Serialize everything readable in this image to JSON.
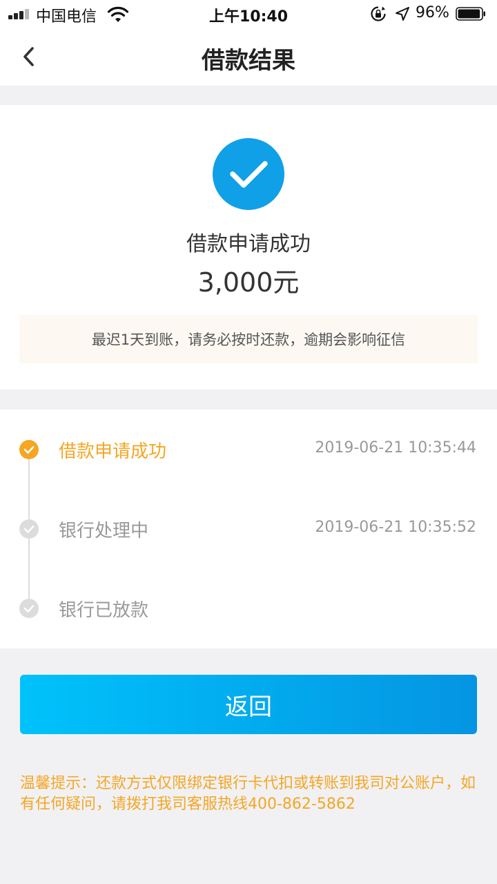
{
  "status_bar": {
    "carrier": "中国电信",
    "time": "上午10:40",
    "battery_percent": "96%",
    "battery_level": 0.96,
    "icons": [
      "signal-icon",
      "wifi-icon",
      "rotation-lock-icon",
      "location-arrow-icon",
      "battery-icon"
    ]
  },
  "nav": {
    "title": "借款结果",
    "back_icon": "chevron-left-icon"
  },
  "result": {
    "icon": "check-circle-icon",
    "title": "借款申请成功",
    "amount": "3,000元",
    "notice": "最迟1天到账，请务必按时还款，逾期会影响征信"
  },
  "timeline": {
    "steps": [
      {
        "label": "借款申请成功",
        "time": "2019-06-21 10:35:44",
        "status": "done"
      },
      {
        "label": "银行处理中",
        "time": "2019-06-21 10:35:52",
        "status": "pending"
      },
      {
        "label": "银行已放款",
        "time": "",
        "status": "pending"
      }
    ]
  },
  "actions": {
    "return_label": "返回"
  },
  "tip": {
    "text": "温馨提示：还款方式仅限绑定银行卡代扣或转账到我司对公账户，如有任何疑问，请拨打我司客服热线400-862-5862"
  },
  "colors": {
    "primary_blue": "#0fa0e8",
    "accent_orange": "#f5a623",
    "gradient_start": "#00c2fb",
    "gradient_end": "#0495e2",
    "inactive_gray": "#999999",
    "notice_bg": "#fdf8f2",
    "page_bg": "#f1f1f3"
  }
}
